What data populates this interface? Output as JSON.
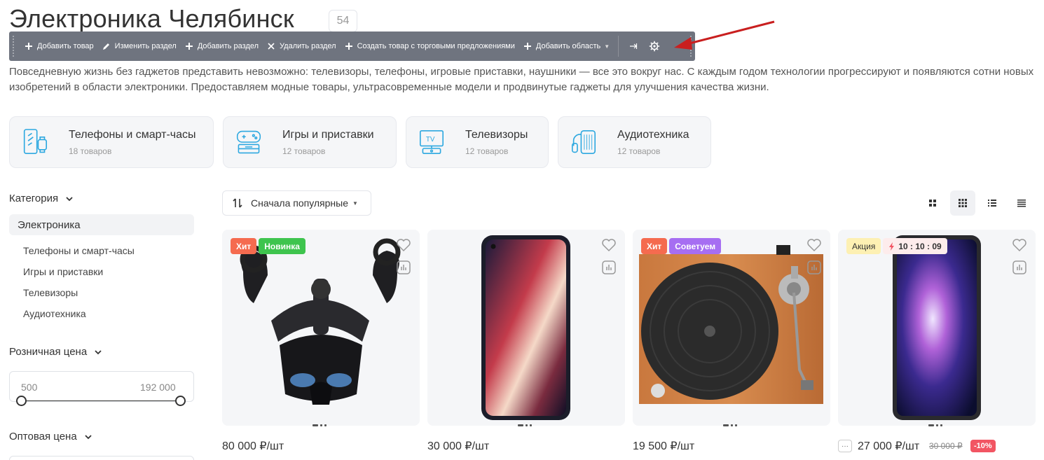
{
  "page": {
    "title": "Электроника Челябинск",
    "count": "54",
    "description": "Повседневную жизнь без гаджетов представить невозможно: телевизоры, телефоны, игровые приставки, наушники — все это вокруг нас. С каждым годом технологии прогрессируют и появляются сотни новых изобретений в области электроники. Предоставляем модные товары, ультрасовременные модели и продвинутые гаджеты для улучшения качества жизни."
  },
  "admin_toolbar": {
    "add_product": "Добавить товар",
    "edit_section": "Изменить раздел",
    "add_section": "Добавить раздел",
    "delete_section": "Удалить раздел",
    "create_product_offers": "Создать товар с торговыми предложениями",
    "add_area": "Добавить область"
  },
  "categories": [
    {
      "name": "Телефоны и смарт-часы",
      "count": "18 товаров",
      "icon": "phone-watch-icon"
    },
    {
      "name": "Игры и приставки",
      "count": "12 товаров",
      "icon": "gamepad-icon"
    },
    {
      "name": "Телевизоры",
      "count": "12 товаров",
      "icon": "tv-icon"
    },
    {
      "name": "Аудиотехника",
      "count": "12 товаров",
      "icon": "headphones-icon"
    }
  ],
  "sidebar": {
    "category_label": "Категория",
    "active": "Электроника",
    "items": [
      "Телефоны и смарт-часы",
      "Игры и приставки",
      "Телевизоры",
      "Аудиотехника"
    ],
    "retail_price_label": "Розничная цена",
    "price_min": "500",
    "price_max": "192 000",
    "wholesale_price_label": "Оптовая цена"
  },
  "sort": {
    "label": "Сначала популярные"
  },
  "products": [
    {
      "badges": [
        "Хит",
        "Новинка"
      ],
      "price": "80 000 ₽/шт"
    },
    {
      "badges": [],
      "price": "30 000 ₽/шт"
    },
    {
      "badges": [
        "Хит",
        "Советуем"
      ],
      "price": "19 500 ₽/шт"
    },
    {
      "badges": [
        "Акция",
        "10 : 10 : 09"
      ],
      "price": "27 000 ₽/шт",
      "old_price": "30 000 ₽",
      "discount": "-10%",
      "more": "···"
    }
  ],
  "colors": {
    "accent_red": "#f56b4f",
    "accent_blue": "#2da8e0",
    "toolbar_bg": "#6f747f"
  }
}
